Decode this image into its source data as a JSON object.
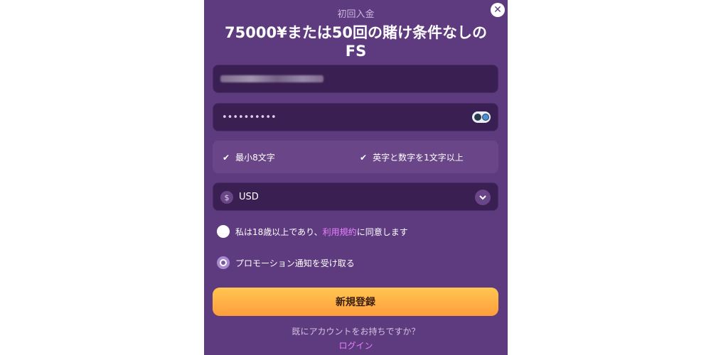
{
  "modal": {
    "close_symbol": "✕",
    "eyebrow": "初回入金",
    "headline_line1": "75000¥または50回の賭け条件なしの",
    "headline_line2": "FS"
  },
  "form": {
    "email_value_redacted": true,
    "password_value": "••••••••••",
    "password_toggle_icon": "eye-icon",
    "rules": [
      {
        "check": "✔",
        "label": "最小8文字"
      },
      {
        "check": "✔",
        "label": "英字と数字を1文字以上"
      }
    ],
    "currency": {
      "symbol": "$",
      "value": "USD",
      "chevron": "⌄"
    },
    "agree": {
      "prefix": "私は18歳以上であり、",
      "link": "利用規約",
      "suffix": "に同意します",
      "checked": false
    },
    "promo": {
      "label": "プロモーション通知を受け取る",
      "checked": true
    },
    "submit_label": "新規登録"
  },
  "footer": {
    "question": "既にアカウントをお持ちですか？",
    "login_link": "ログイン"
  },
  "colors": {
    "modal_bg": "#5e3a7e",
    "field_bg": "#3a1f52",
    "button_gradient_top": "#ffc650",
    "button_gradient_bottom": "#ff9d3d",
    "link": "#e880ff"
  }
}
